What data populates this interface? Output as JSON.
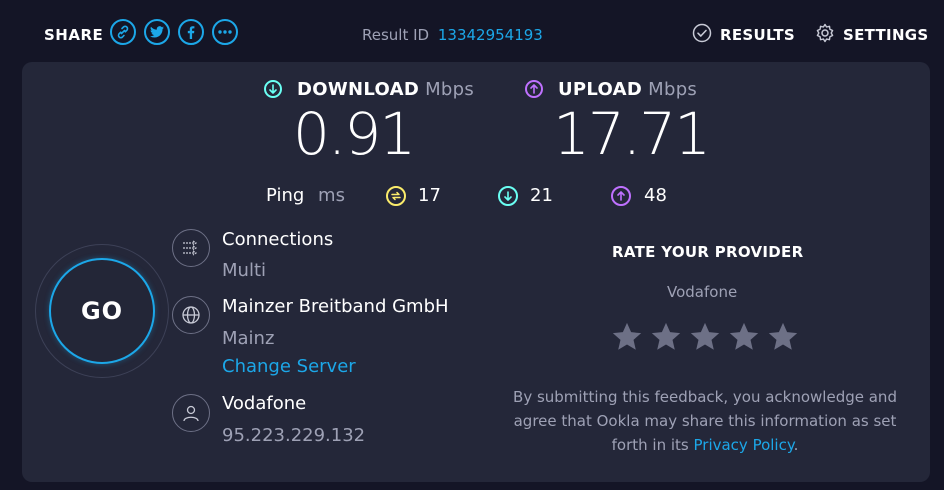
{
  "header": {
    "share_label": "SHARE",
    "share_icons": [
      "link-icon",
      "twitter-icon",
      "facebook-icon",
      "more-icon"
    ],
    "result_id_label": "Result ID",
    "result_id_value": "13342954193",
    "results_label": "RESULTS",
    "settings_label": "SETTINGS"
  },
  "metrics": {
    "download": {
      "label": "DOWNLOAD",
      "unit": "Mbps",
      "value": "0.91",
      "color": "#6afff3"
    },
    "upload": {
      "label": "UPLOAD",
      "unit": "Mbps",
      "value": "17.71",
      "color": "#bf71ff"
    }
  },
  "ping": {
    "label": "Ping",
    "unit": "ms",
    "idle": {
      "value": "17",
      "color": "#fbec6b"
    },
    "download": {
      "value": "21",
      "color": "#6afff3"
    },
    "upload": {
      "value": "48",
      "color": "#bf71ff"
    }
  },
  "go_label": "GO",
  "connection": {
    "connections_title": "Connections",
    "connections_value": "Multi",
    "server_title": "Mainzer Breitband GmbH",
    "server_location": "Mainz",
    "change_server_label": "Change Server",
    "isp_title": "Vodafone",
    "ip_address": "95.223.229.132"
  },
  "rating": {
    "title": "RATE YOUR PROVIDER",
    "provider": "Vodafone",
    "stars": 5,
    "disclaimer_text": "By submitting this feedback, you acknowledge and agree that Ookla may share this information as set forth in its",
    "privacy_link": "Privacy Policy",
    "disclaimer_end": "."
  },
  "colors": {
    "background": "#141526",
    "panel": "#242739",
    "accent": "#1ca7e8",
    "muted": "#9ea1b5",
    "star": "#6d7086"
  }
}
